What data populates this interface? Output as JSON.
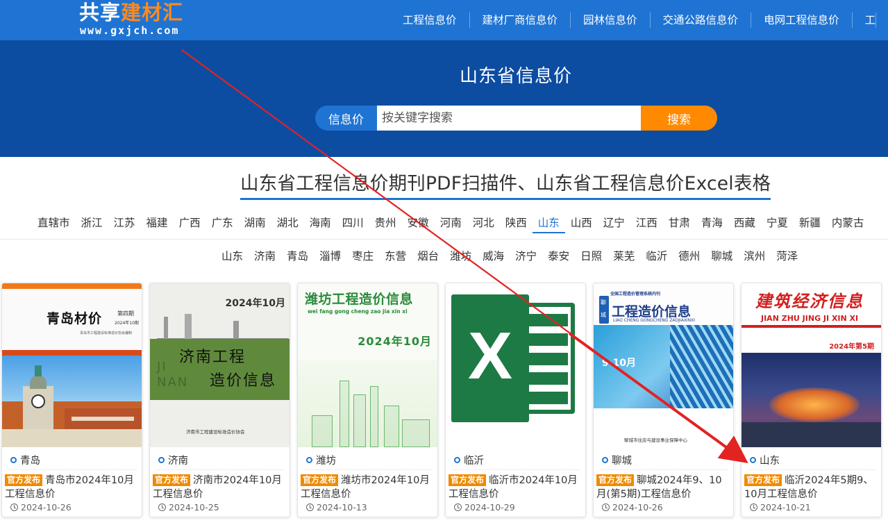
{
  "brand": {
    "logo_part1": "共享",
    "logo_part2": "建材汇",
    "logo_url": "www.gxjch.com"
  },
  "topnav": [
    {
      "label": "工程信息价"
    },
    {
      "label": "建材厂商信息价"
    },
    {
      "label": "园林信息价"
    },
    {
      "label": "交通公路信息价"
    },
    {
      "label": "电网工程信息价"
    },
    {
      "label": "工"
    }
  ],
  "hero": {
    "title": "山东省信息价",
    "search_label": "信息价",
    "search_placeholder": "按关键字搜索",
    "search_button": "搜索"
  },
  "section_title": "山东省工程信息价期刊PDF扫描件、山东省工程信息价Excel表格",
  "provinces": [
    "直辖市",
    "浙江",
    "江苏",
    "福建",
    "广西",
    "广东",
    "湖南",
    "湖北",
    "海南",
    "四川",
    "贵州",
    "安徽",
    "河南",
    "河北",
    "陕西",
    "山东",
    "山西",
    "辽宁",
    "江西",
    "甘肃",
    "青海",
    "西藏",
    "宁夏",
    "新疆",
    "内蒙古"
  ],
  "active_province": "山东",
  "cities": [
    "山东",
    "济南",
    "青岛",
    "淄博",
    "枣庄",
    "东营",
    "烟台",
    "潍坊",
    "威海",
    "济宁",
    "泰安",
    "日照",
    "莱芜",
    "临沂",
    "德州",
    "聊城",
    "滨州",
    "菏泽"
  ],
  "badge_label": "官方发布",
  "cards": [
    {
      "city": "青岛",
      "title": "青岛市2024年10月工程信息价",
      "date": "2024-10-26",
      "cover": {
        "title": "青岛材价",
        "issue": "第四期",
        "month": "2024年10期",
        "publisher": "青岛市工程建设标准造价协会编制",
        "tag": "青岛"
      }
    },
    {
      "city": "济南",
      "title": "济南市2024年10月工程信息价",
      "date": "2024-10-25",
      "cover": {
        "date": "2024年10月",
        "line1": "济南工程",
        "line2": "造价信息",
        "watermark": "JI NAN",
        "publisher": "济南市工程建设标准造价协会"
      }
    },
    {
      "city": "潍坊",
      "title": "潍坊市2024年10月工程信息价",
      "date": "2024-10-13",
      "cover": {
        "title": "潍坊工程造价信息",
        "pinyin": "wei fang gong cheng zao jia xin xi",
        "date": "2024年10月"
      }
    },
    {
      "city": "临沂",
      "title": "临沂市2024年10月工程信息价",
      "date": "2024-10-29",
      "cover": {
        "letter": "X"
      }
    },
    {
      "city": "聊城",
      "title": "聊城2024年9、10月(第5期)工程信息价",
      "date": "2024-10-26",
      "cover": {
        "header": "全国工程造价管理系统内刊",
        "title": "工程造价信息",
        "pinyin": "LIAO CHENG GONGCHENG ZAOJIAXINXI",
        "logo_top": "聊",
        "logo_bottom": "城",
        "issue": "9-10月",
        "footer": "聊城市住房与建设事业保障中心"
      }
    },
    {
      "city": "山东",
      "title": "临沂2024年5期9、10月工程信息价",
      "date": "2024-10-21",
      "cover": {
        "title": "建筑经济信息",
        "pinyin": "JIAN ZHU JING JI XIN XI",
        "issue": "2024年第5期"
      }
    }
  ]
}
